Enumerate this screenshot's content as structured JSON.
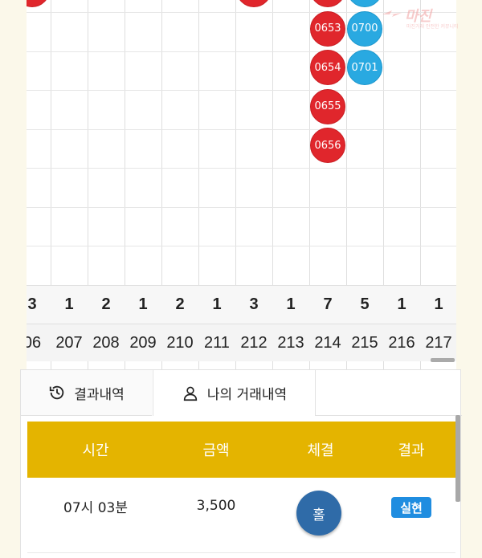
{
  "board": {
    "columns": [
      {
        "count": "3",
        "index": "06",
        "beads": [
          {
            "label": "",
            "color": "red"
          }
        ]
      },
      {
        "count": "1",
        "index": "207",
        "beads": []
      },
      {
        "count": "2",
        "index": "208",
        "beads": []
      },
      {
        "count": "1",
        "index": "209",
        "beads": []
      },
      {
        "count": "2",
        "index": "210",
        "beads": []
      },
      {
        "count": "1",
        "index": "211",
        "beads": []
      },
      {
        "count": "3",
        "index": "212",
        "beads": [
          {
            "label": "",
            "color": "red"
          }
        ]
      },
      {
        "count": "1",
        "index": "213",
        "beads": []
      },
      {
        "count": "7",
        "index": "214",
        "beads": [
          {
            "label": "",
            "color": "red"
          },
          {
            "label": "0653",
            "color": "red"
          },
          {
            "label": "0654",
            "color": "red"
          },
          {
            "label": "0655",
            "color": "red"
          },
          {
            "label": "0656",
            "color": "red"
          }
        ]
      },
      {
        "count": "5",
        "index": "215",
        "beads": [
          {
            "label": "",
            "color": "blue"
          },
          {
            "label": "0700",
            "color": "blue"
          },
          {
            "label": "0701",
            "color": "blue"
          }
        ]
      },
      {
        "count": "1",
        "index": "216",
        "beads": []
      },
      {
        "count": "1",
        "index": "217",
        "beads": []
      }
    ],
    "colors": {
      "red": "#e0262c",
      "blue": "#29a9e1",
      "header": "#e4b400",
      "button": "#2f6ba8",
      "badge": "#1f8de0"
    }
  },
  "watermark": {
    "text": "마진",
    "sub": "마진거래 안전한 커뮤니티"
  },
  "tabs": [
    {
      "label": "결과내역",
      "icon": "history-icon"
    },
    {
      "label": "나의 거래내역",
      "icon": "user-icon"
    }
  ],
  "table": {
    "headers": [
      "시간",
      "금액",
      "체결",
      "결과"
    ],
    "rows": [
      {
        "time": "07시 03분",
        "amount": "3,500",
        "fill": "홀",
        "result": "실현"
      }
    ]
  }
}
